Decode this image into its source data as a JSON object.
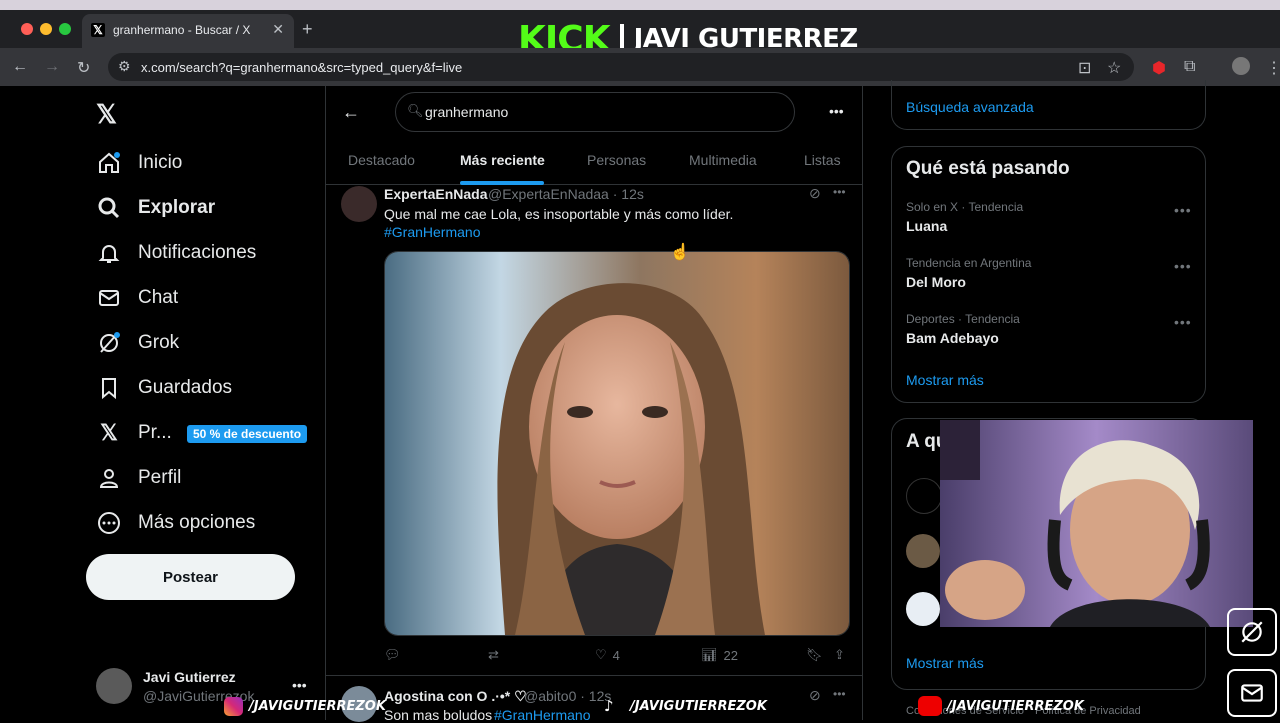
{
  "browser": {
    "tab_title": "granhermano - Buscar / X",
    "url": "x.com/search?q=granhermano&src=typed_query&f=live"
  },
  "overlay": {
    "kick_logo": "KICK",
    "streamer_name": "JAVI GUTIERREZ",
    "instagram_handle": "/JAVIGUTIERREZOK",
    "tiktok_handle": "/JAVIGUTIERREZOK",
    "youtube_handle": "/JAVIGUTIERREZOK"
  },
  "sidebar": {
    "items": [
      {
        "label": "Inicio"
      },
      {
        "label": "Explorar"
      },
      {
        "label": "Notificaciones"
      },
      {
        "label": "Chat"
      },
      {
        "label": "Grok"
      },
      {
        "label": "Guardados"
      },
      {
        "label": "Pr..."
      },
      {
        "label": "Perfil"
      },
      {
        "label": "Más opciones"
      }
    ],
    "premium_badge": "50 % de descuento",
    "post_button": "Postear",
    "account_name": "Javi Gutierrez",
    "account_handle": "@JaviGutierrezok"
  },
  "search": {
    "query": "granhermano",
    "tabs": [
      "Destacado",
      "Más reciente",
      "Personas",
      "Multimedia",
      "Listas"
    ],
    "active_tab": "Más reciente"
  },
  "tweets": [
    {
      "name": "ExpertaEnNada",
      "handle": "@ExpertaEnNadaa · 12s",
      "text": "Que mal me cae Lola, es insoportable y más como líder.",
      "hashtag": "#GranHermano",
      "likes": "4",
      "views": "22"
    },
    {
      "name": "Agostina con O .·•* ♡",
      "handle": "@abito0 · 12s",
      "text": "Son mas boludos",
      "hashtag": "#GranHermano"
    }
  ],
  "right": {
    "advanced_search": "Búsqueda avanzada",
    "whats_happening_title": "Qué está pasando",
    "trends": [
      {
        "category": "Solo en X · Tendencia",
        "name": "Luana"
      },
      {
        "category": "Tendencia en Argentina",
        "name": "Del Moro"
      },
      {
        "category": "Deportes · Tendencia",
        "name": "Bam Adebayo"
      }
    ],
    "show_more": "Mostrar más",
    "who_to_follow_title": "A qu",
    "show_more_2": "Mostrar más",
    "footer_privacy": "Política de Privacidad",
    "footer_terms": "Condiciones de Servicio"
  },
  "colors": {
    "accent": "#1d9bf0",
    "kick_green": "#53fc18"
  }
}
